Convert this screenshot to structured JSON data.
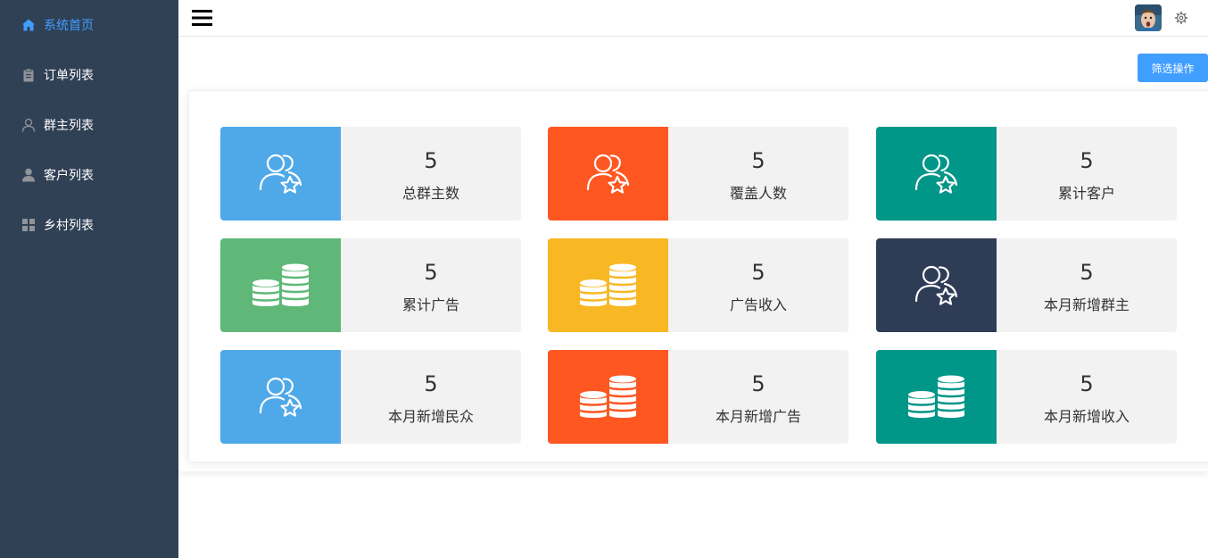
{
  "sidebar": {
    "items": [
      {
        "label": "系统首页",
        "icon": "home-icon",
        "active": true
      },
      {
        "label": "订单列表",
        "icon": "clipboard-icon",
        "active": false
      },
      {
        "label": "群主列表",
        "icon": "user-outline-icon",
        "active": false
      },
      {
        "label": "客户列表",
        "icon": "user-solid-icon",
        "active": false
      },
      {
        "label": "乡村列表",
        "icon": "grid-icon",
        "active": false
      }
    ]
  },
  "header": {
    "menu_icon": "hamburger-icon",
    "avatar_icon": "avatar-icon",
    "settings_icon": "gear-icon"
  },
  "toolbar": {
    "filter_label": "筛选操作"
  },
  "colors": {
    "sidebar_bg": "#304156",
    "accent": "#409eff",
    "blue": "#4fa9e8",
    "orange": "#fe5722",
    "teal": "#009688",
    "green": "#5fb878",
    "yellow": "#f7b824",
    "navy": "#2f3c55"
  },
  "cards": [
    {
      "value": "5",
      "label": "总群主数",
      "color": "#4fa9e8",
      "icon": "users-star-icon"
    },
    {
      "value": "5",
      "label": "覆盖人数",
      "color": "#fe5722",
      "icon": "users-star-icon"
    },
    {
      "value": "5",
      "label": "累计客户",
      "color": "#009688",
      "icon": "users-star-icon"
    },
    {
      "value": "5",
      "label": "累计广告",
      "color": "#5fb878",
      "icon": "coins-icon"
    },
    {
      "value": "5",
      "label": "广告收入",
      "color": "#f7b824",
      "icon": "coins-icon"
    },
    {
      "value": "5",
      "label": "本月新增群主",
      "color": "#2f3c55",
      "icon": "users-star-icon"
    },
    {
      "value": "5",
      "label": "本月新增民众",
      "color": "#4fa9e8",
      "icon": "users-star-icon"
    },
    {
      "value": "5",
      "label": "本月新增广告",
      "color": "#fe5722",
      "icon": "coins-icon"
    },
    {
      "value": "5",
      "label": "本月新增收入",
      "color": "#009688",
      "icon": "coins-icon"
    }
  ]
}
